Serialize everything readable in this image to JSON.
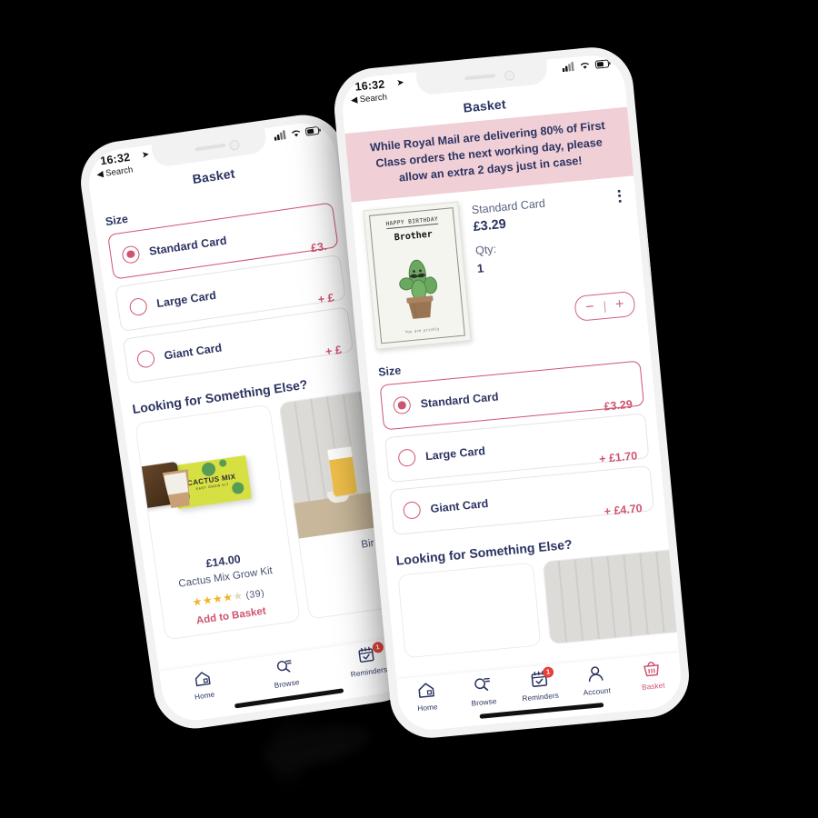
{
  "background": "#000000",
  "colors": {
    "accent_pink": "#cf5470",
    "navy": "#2b3361",
    "banner_bg": "#f0cfd6",
    "badge_red": "#e8413a",
    "star_gold": "#f0b429",
    "phone_body": "#f3f2f2"
  },
  "status_bar": {
    "time": "16:32",
    "back_label": "Search",
    "location_icon": "location-arrow-icon",
    "cellular_icon": "cellular-signal-icon",
    "wifi_icon": "wifi-icon",
    "battery_icon": "battery-icon"
  },
  "nav": {
    "title": "Basket"
  },
  "banner": {
    "text": "While Royal Mail are delivering 80% of First Class orders the next working day, please allow an extra 2 days just in case!"
  },
  "basket_item": {
    "card_art": {
      "greeting": "HAPPY BIRTHDAY",
      "recipient": "Brother",
      "footnote": "You are prickly",
      "illustration": "cactus-with-moustache-in-pot"
    },
    "size_label": "Standard Card",
    "price": "£3.29",
    "qty_label": "Qty:",
    "qty_value": "1",
    "menu_icon": "kebab-menu-icon",
    "stepper": {
      "decrease": "−",
      "divider": "|",
      "increase": "+"
    }
  },
  "size_section": {
    "heading": "Size",
    "options": [
      {
        "label": "Standard Card",
        "price": "£3.29",
        "selected": true
      },
      {
        "label": "Large Card",
        "price": "+ £1.70",
        "selected": false
      },
      {
        "label": "Giant Card",
        "price": "+ £4.70",
        "selected": false
      }
    ]
  },
  "recommendations": {
    "heading": "Looking for Something Else?",
    "products": [
      {
        "price": "£14.00",
        "name": "Cactus Mix Grow Kit",
        "rating_stars": "★★★★",
        "half_star": "★",
        "review_count": "(39)",
        "cta": "Add to Basket",
        "image": "cactus-mix-grow-kit-photo",
        "box_label": "CACTUS MIX",
        "box_sub": "EASY GROW KIT"
      },
      {
        "name": "Bir",
        "image": "beer-glass-photo"
      }
    ]
  },
  "tab_bar": {
    "items": [
      {
        "label": "Home",
        "icon": "home-icon",
        "active": false,
        "badge": null
      },
      {
        "label": "Browse",
        "icon": "search-magnifier-icon",
        "active": false,
        "badge": null
      },
      {
        "label": "Reminders",
        "icon": "calendar-check-icon",
        "active": false,
        "badge": "1"
      },
      {
        "label": "Account",
        "icon": "person-icon",
        "active": false,
        "badge": null
      },
      {
        "label": "Basket",
        "icon": "basket-icon",
        "active": true,
        "badge": null
      }
    ]
  },
  "back_phone": {
    "nav_title": "Basket",
    "size_heading": "Size",
    "options": [
      {
        "label": "Standard Card",
        "price": "£3.",
        "selected": true
      },
      {
        "label": "Large Card",
        "price": "+ £",
        "selected": false
      },
      {
        "label": "Giant Card",
        "price": "+ £",
        "selected": false
      }
    ],
    "rec_heading": "Looking for Something Else?"
  }
}
